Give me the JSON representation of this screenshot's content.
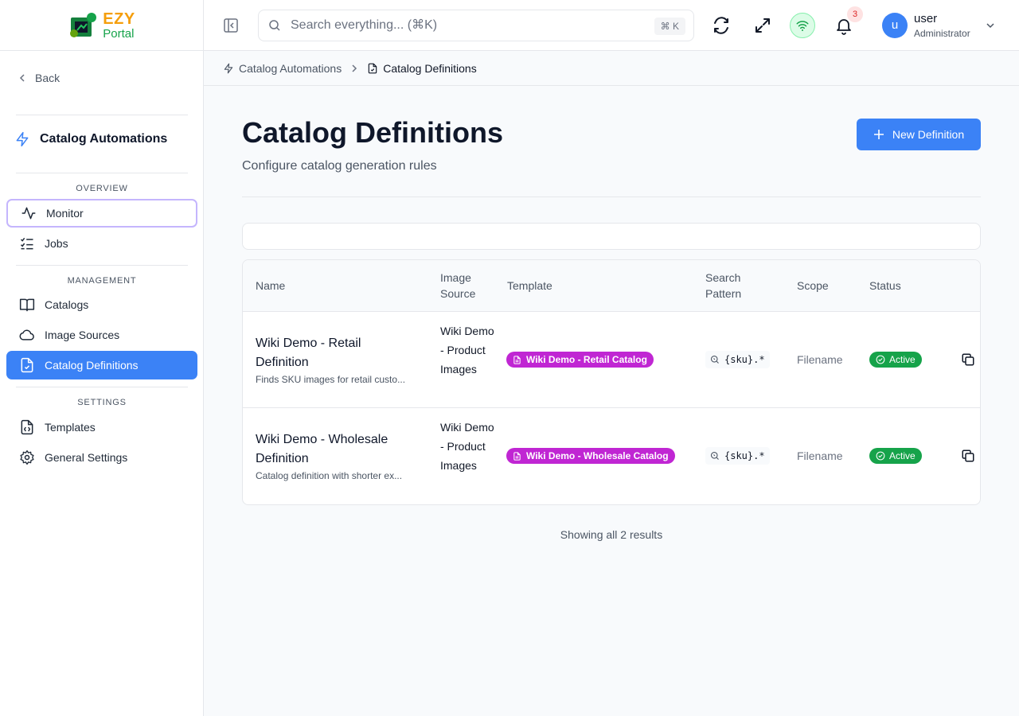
{
  "logo": {
    "brand": "EZY",
    "product": "Portal"
  },
  "sidebar": {
    "back_label": "Back",
    "section_title": "Catalog Automations",
    "groups": {
      "overview": "OVERVIEW",
      "management": "MANAGEMENT",
      "settings": "SETTINGS"
    },
    "items": {
      "monitor": "Monitor",
      "jobs": "Jobs",
      "catalogs": "Catalogs",
      "image_sources": "Image Sources",
      "catalog_definitions": "Catalog Definitions",
      "templates": "Templates",
      "general_settings": "General Settings"
    },
    "active_item": "catalog_definitions"
  },
  "topbar": {
    "search_placeholder": "Search everything... (⌘K)",
    "search_shortcut": "⌘ K",
    "notification_count": "3",
    "user": {
      "initial": "u",
      "name": "user",
      "role": "Administrator"
    },
    "connection_color": "#16a34a"
  },
  "breadcrumb": {
    "parent": "Catalog Automations",
    "current": "Catalog Definitions"
  },
  "page": {
    "title": "Catalog Definitions",
    "subtitle": "Configure catalog generation rules",
    "new_button": "New Definition",
    "accent_color": "#3b82f6"
  },
  "table": {
    "headers": {
      "name": "Name",
      "image_source": "Image Source",
      "template": "Template",
      "search_pattern": "Search Pattern",
      "scope": "Scope",
      "status": "Status"
    },
    "rows": [
      {
        "name": "Wiki Demo - Retail Definition",
        "description": "Finds SKU images for retail custo...",
        "image_source": "Wiki Demo - Product Images",
        "template": "Wiki Demo - Retail Catalog",
        "pattern": "{sku}.*",
        "scope": "Filename",
        "status": "Active"
      },
      {
        "name": "Wiki Demo - Wholesale Definition",
        "description": "Catalog definition with shorter ex...",
        "image_source": "Wiki Demo - Product Images",
        "template": "Wiki Demo - Wholesale Catalog",
        "pattern": "{sku}.*",
        "scope": "Filename",
        "status": "Active"
      }
    ],
    "results_text": "Showing all 2 results"
  }
}
